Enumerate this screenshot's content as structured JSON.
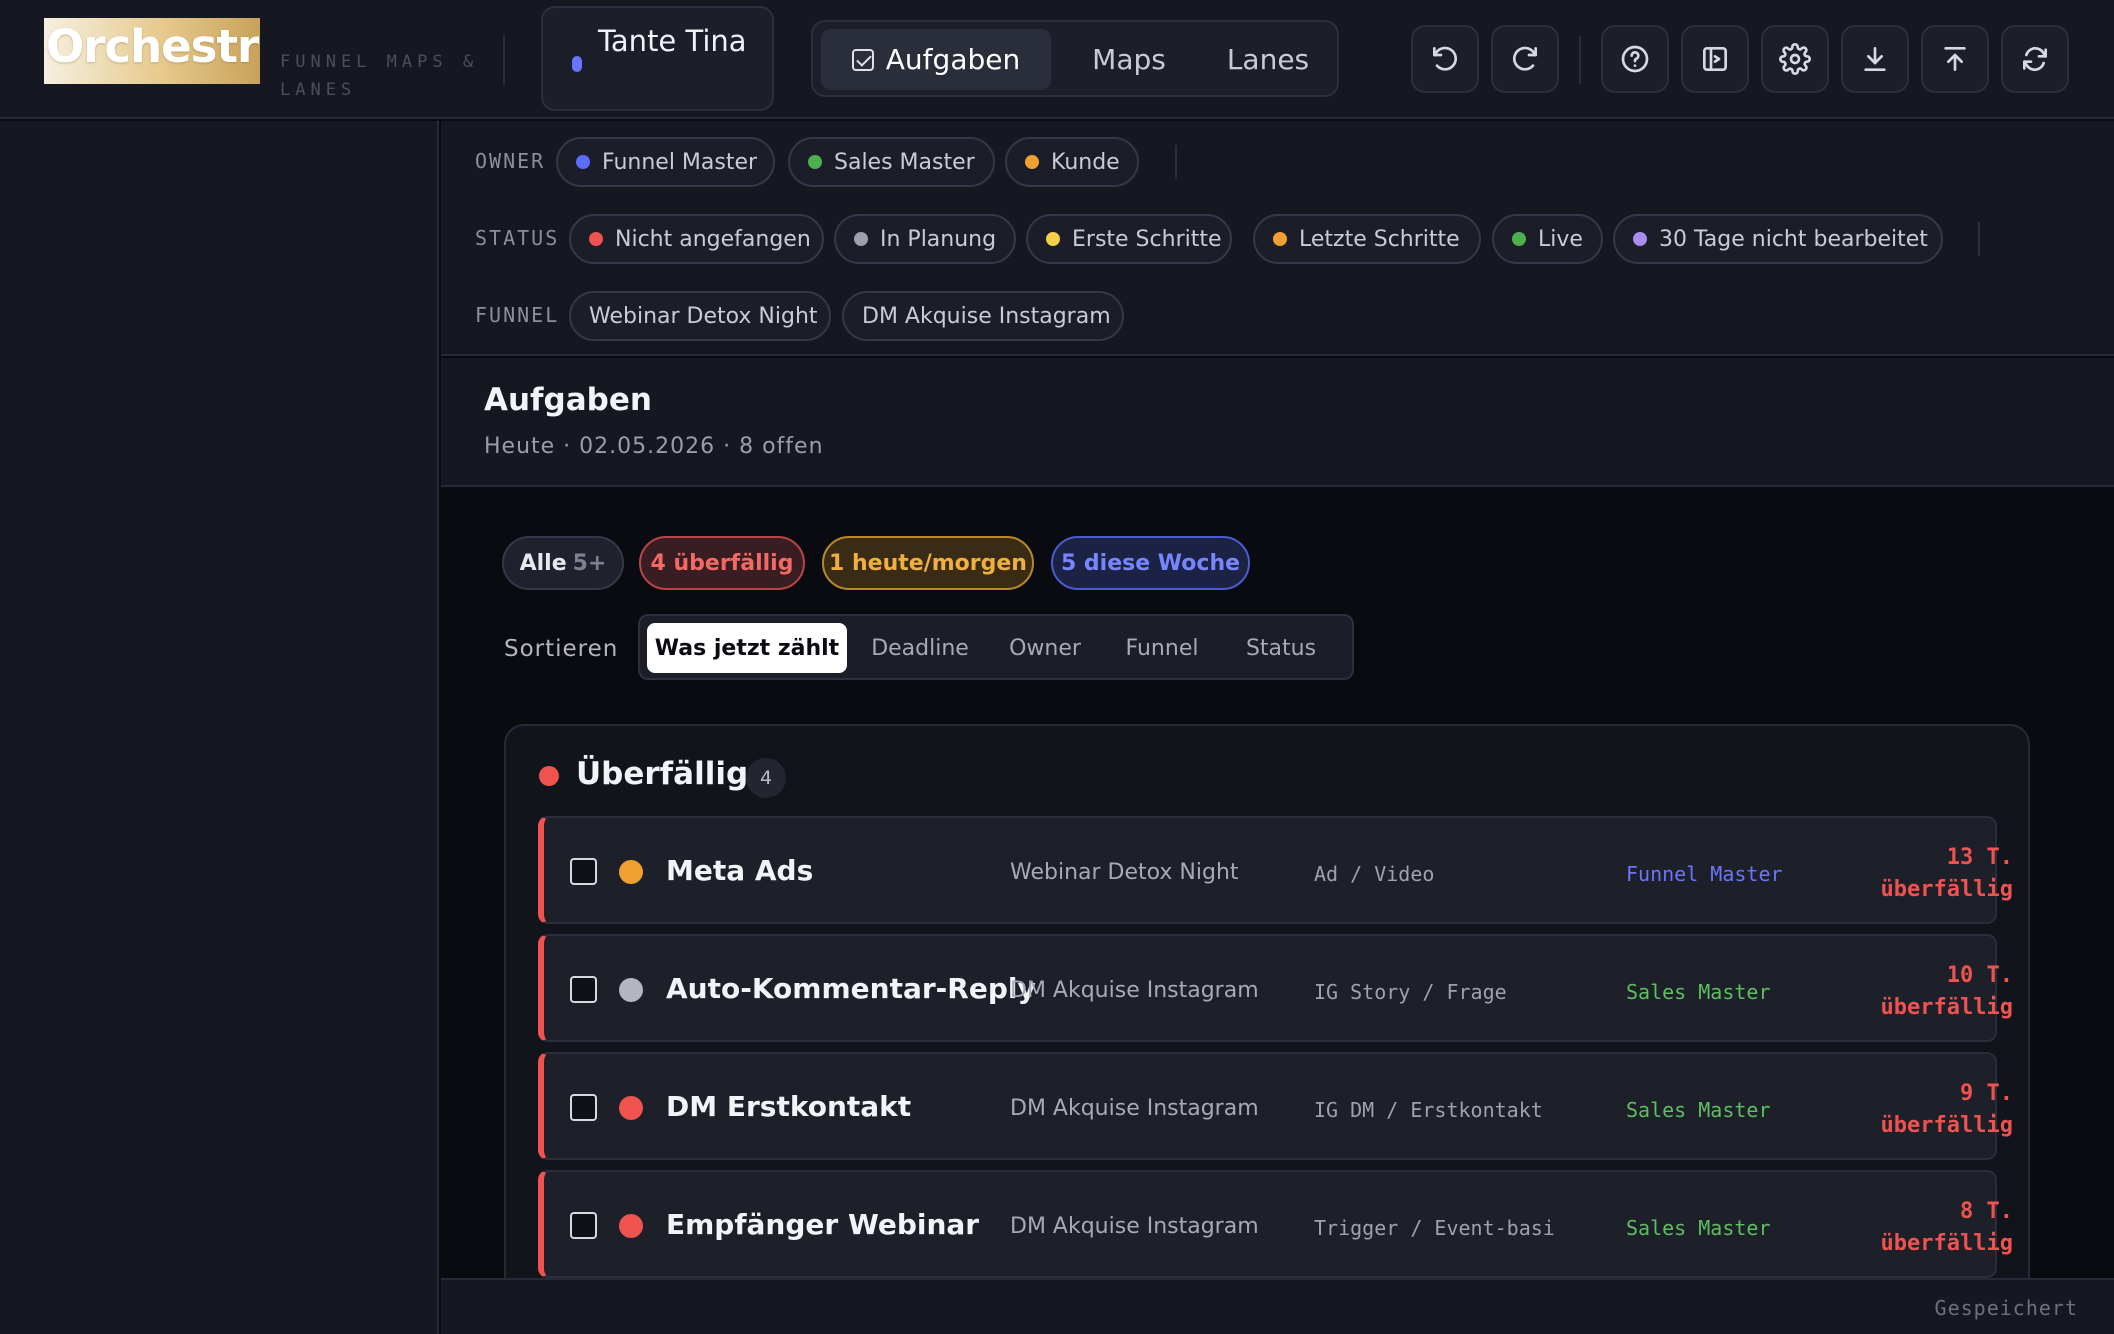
{
  "app": {
    "logo_text": "Orchestra",
    "tagline": "FUNNEL MAPS & LANES",
    "workspace": "Tante Tina"
  },
  "nav": {
    "tabs": [
      {
        "label": "Aufgaben",
        "active": true
      },
      {
        "label": "Maps",
        "active": false
      },
      {
        "label": "Lanes",
        "active": false
      }
    ]
  },
  "toolbar": {
    "icons": [
      "undo-icon",
      "redo-icon",
      "help-icon",
      "panel-toggle-icon",
      "settings-icon",
      "download-icon",
      "upload-icon",
      "refresh-icon"
    ]
  },
  "filters": {
    "owner": {
      "label": "OWNER",
      "items": [
        {
          "label": "Funnel Master",
          "color": "#5b6cff"
        },
        {
          "label": "Sales Master",
          "color": "#4caf50"
        },
        {
          "label": "Kunde",
          "color": "#f0a030"
        }
      ]
    },
    "status": {
      "label": "STATUS",
      "items": [
        {
          "label": "Nicht angefangen",
          "color": "#ef5350"
        },
        {
          "label": "In Planung",
          "color": "#9e9fad"
        },
        {
          "label": "Erste Schritte",
          "color": "#f2d04a"
        },
        {
          "label": "Letzte Schritte",
          "color": "#f0a030"
        },
        {
          "label": "Live",
          "color": "#4caf50"
        },
        {
          "label": "30 Tage nicht bearbeitet",
          "color": "#a98cf0"
        }
      ]
    },
    "funnel": {
      "label": "FUNNEL",
      "items": [
        {
          "label": "Webinar Detox Night"
        },
        {
          "label": "DM Akquise Instagram"
        }
      ]
    }
  },
  "tasks_header": {
    "title": "Aufgaben",
    "subtitle": "Heute · 02.05.2026  ·  8 offen"
  },
  "quick_filters": {
    "all_label": "Alle",
    "all_count": "5+",
    "overdue": "4 überfällig",
    "today": "1 heute/morgen",
    "week": "5 diese Woche"
  },
  "sort": {
    "label": "Sortieren",
    "options": [
      {
        "label": "Was jetzt zählt",
        "active": true
      },
      {
        "label": "Deadline",
        "active": false
      },
      {
        "label": "Owner",
        "active": false
      },
      {
        "label": "Funnel",
        "active": false
      },
      {
        "label": "Status",
        "active": false
      }
    ]
  },
  "group": {
    "title": "Überfällig",
    "count": "4",
    "color": "#ef5350",
    "rows": [
      {
        "title": "Meta Ads",
        "status_color": "#f0a030",
        "funnel": "Webinar Detox Night",
        "type": "Ad / Video",
        "owner": "Funnel Master",
        "owner_color": "#6a74ff",
        "due_line1": "13 T.",
        "due_line2": "überfällig"
      },
      {
        "title": "Auto-Kommentar-Reply",
        "status_color": "#b5b6c2",
        "funnel": "DM Akquise Instagram",
        "type": "IG Story / Frage",
        "owner": "Sales Master",
        "owner_color": "#5cbf60",
        "due_line1": "10 T.",
        "due_line2": "überfällig"
      },
      {
        "title": "DM Erstkontakt",
        "status_color": "#ef5350",
        "funnel": "DM Akquise Instagram",
        "type": "IG DM / Erstkontakt",
        "owner": "Sales Master",
        "owner_color": "#5cbf60",
        "due_line1": "9 T.",
        "due_line2": "überfällig"
      },
      {
        "title": "Empfänger Webinar",
        "status_color": "#ef5350",
        "funnel": "DM Akquise Instagram",
        "type": "Trigger / Event-basi",
        "owner": "Sales Master",
        "owner_color": "#5cbf60",
        "due_line1": "8 T.",
        "due_line2": "überfällig"
      }
    ]
  },
  "footer": {
    "status": "Gespeichert"
  }
}
